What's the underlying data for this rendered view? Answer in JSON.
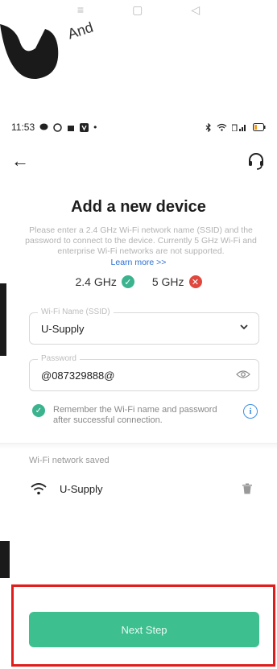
{
  "topnav": {
    "menu_glyph": "≡",
    "home_glyph": "▢",
    "back_glyph": "◁"
  },
  "decor": {
    "blob_text": "And"
  },
  "status": {
    "time": "11:53",
    "dot": "•"
  },
  "appbar": {
    "back_glyph": "←"
  },
  "page": {
    "title": "Add a new device",
    "description": "Please enter a 2.4 GHz Wi-Fi network name (SSID) and the password to connect to the device. Currently 5 GHz Wi-Fi and enterprise Wi-Fi networks are not supported.",
    "learn_more": "Learn more >>",
    "band_24": "2.4 GHz",
    "band_5": "5 GHz"
  },
  "form": {
    "ssid_label": "Wi-Fi Name (SSID)",
    "ssid_value": "U-Supply",
    "password_label": "Password",
    "password_value": "@087329888@",
    "remember_text": "Remember the Wi-Fi name and password after successful connection.",
    "info_glyph": "i"
  },
  "saved": {
    "label": "Wi-Fi network saved",
    "network_name": "U-Supply"
  },
  "actions": {
    "next_label": "Next Step"
  },
  "colors": {
    "accent": "#3dbf90",
    "ok": "#3bb38e",
    "error": "#e0483e",
    "link": "#2a6fd6",
    "highlight_box": "#e21b1b"
  }
}
